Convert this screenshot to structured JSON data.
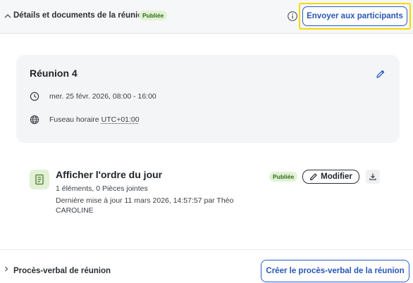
{
  "header": {
    "title": "Détails et documents de la réunion",
    "status_badge": "Publiée",
    "send_button": "Envoyer aux participants"
  },
  "meeting": {
    "title": "Réunion 4",
    "datetime": "mer. 25 févr. 2026, 08:00 - 16:00",
    "timezone_label": "Fuseau horaire",
    "timezone_value": "UTC+01:00"
  },
  "agenda": {
    "title": "Afficher l'ordre du jour",
    "counts": "1 éléments, 0 Pièces jointes",
    "updated_line1": "Dernière mise à jour 11 mars 2026, 14:57:57 par Théo",
    "updated_line2": "CAROLINE",
    "status_badge": "Publiée",
    "modify_button": "Modifier"
  },
  "footer": {
    "title": "Procès-verbal de réunion",
    "create_button": "Créer le procès-verbal de la réunion"
  },
  "colors": {
    "accent": "#2857b8",
    "highlight": "#f5d90a",
    "badge_bg": "#e2f2d5",
    "badge_text": "#2f6b1a"
  },
  "icons": [
    "chevron-up-icon",
    "info-icon",
    "pencil-icon",
    "clock-icon",
    "globe-icon",
    "document-icon",
    "download-icon",
    "chevron-right-icon"
  ]
}
